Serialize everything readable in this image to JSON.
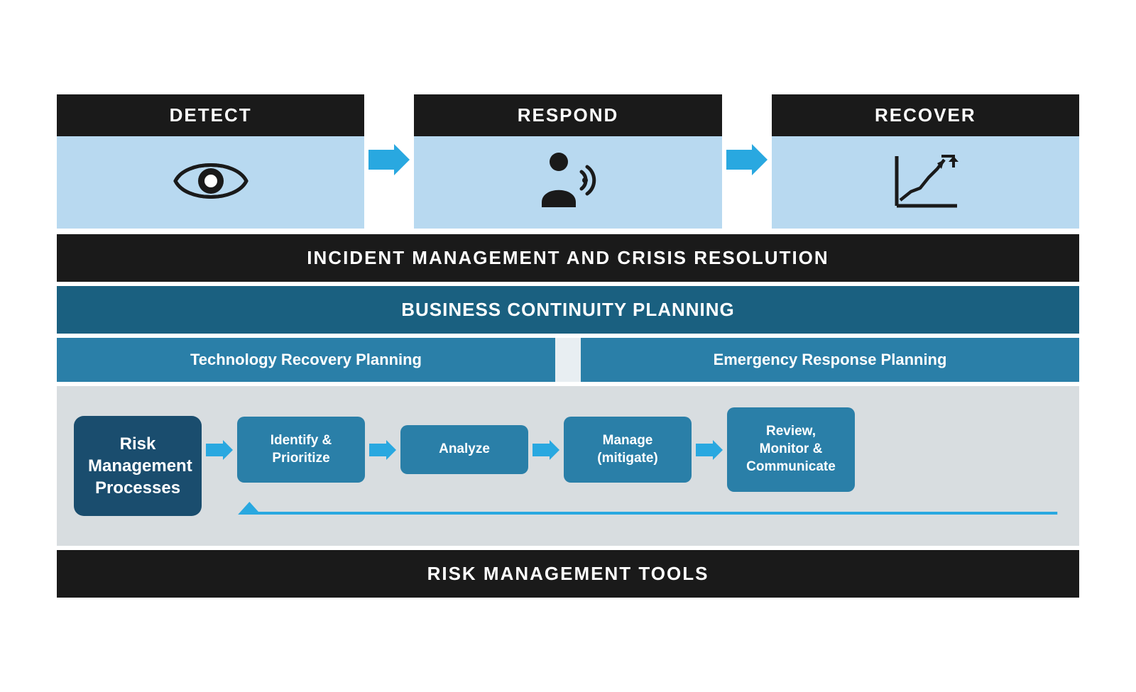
{
  "phases": {
    "detect": {
      "label": "DETECT",
      "icon": "eye-icon"
    },
    "respond": {
      "label": "RESPOND",
      "icon": "respond-icon"
    },
    "recover": {
      "label": "RECOVER",
      "icon": "recover-icon"
    }
  },
  "incident_banner": "INCIDENT MANAGEMENT AND CRISIS RESOLUTION",
  "bcp_banner": "BUSINESS CONTINUITY PLANNING",
  "sub_planning": {
    "technology": "Technology Recovery Planning",
    "emergency": "Emergency Response Planning"
  },
  "risk_processes": {
    "main_label": "Risk\nManagement\nProcesses",
    "steps": [
      "Identify &\nPrioritize",
      "Analyze",
      "Manage\n(mitigate)",
      "Review,\nMonitor &\nCommunicate"
    ]
  },
  "tools_banner": "RISK MANAGEMENT TOOLS",
  "colors": {
    "black": "#1a1a1a",
    "light_blue_bg": "#b8d9f0",
    "dark_teal": "#1a6080",
    "medium_blue": "#2a7fa8",
    "dark_navy": "#1a4d6e",
    "arrow_blue": "#29a8e0",
    "gray_bg": "#d8dde0",
    "sub_bg": "#e8eef2"
  }
}
